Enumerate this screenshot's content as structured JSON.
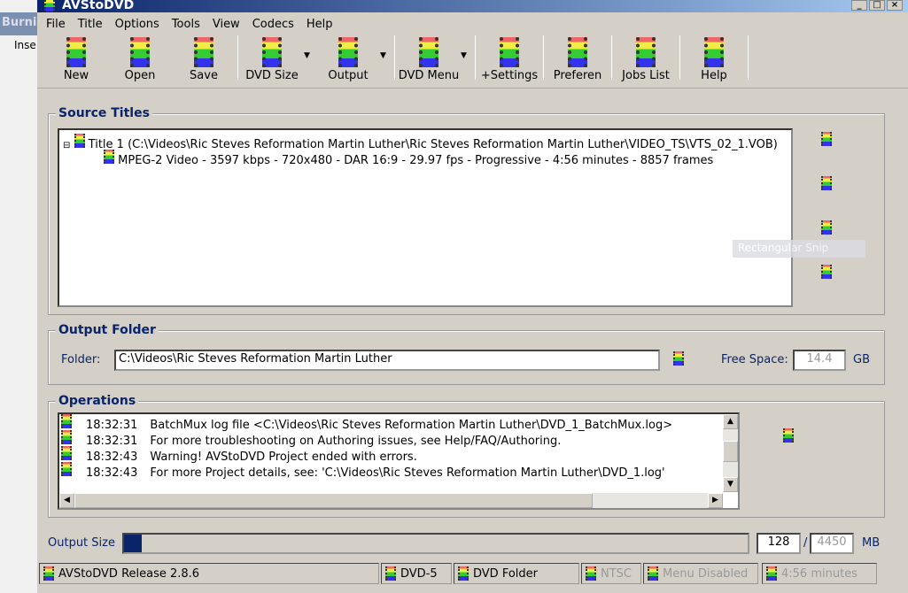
{
  "app": {
    "title": "AVStoDVD"
  },
  "background": {
    "burn_label": "Burnin",
    "insert_label": "Inse"
  },
  "menu": [
    "File",
    "Title",
    "Options",
    "Tools",
    "View",
    "Codecs",
    "Help"
  ],
  "toolbar": [
    {
      "label": "New",
      "dropdown": false,
      "sep_after": false
    },
    {
      "label": "Open",
      "dropdown": false,
      "sep_after": false
    },
    {
      "label": "Save",
      "dropdown": false,
      "sep_after": true
    },
    {
      "label": "DVD Size",
      "dropdown": true,
      "sep_after": false
    },
    {
      "label": "Output",
      "dropdown": true,
      "sep_after": true
    },
    {
      "label": "DVD Menu",
      "dropdown": true,
      "sep_after": true
    },
    {
      "label": "+Settings",
      "dropdown": false,
      "sep_after": true
    },
    {
      "label": "Preferen",
      "dropdown": false,
      "sep_after": true
    },
    {
      "label": "Jobs List",
      "dropdown": false,
      "sep_after": true
    },
    {
      "label": "Help",
      "dropdown": false,
      "sep_after": true
    }
  ],
  "source": {
    "title": "Source Titles",
    "tree_title": "Title 1 (C:\\Videos\\Ric Steves Reformation Martin Luther\\Ric Steves Reformation Martin Luther\\VIDEO_TS\\VTS_02_1.VOB)",
    "tree_child": "MPEG-2 Video - 3597 kbps - 720x480 - DAR 16:9 - 29.97 fps - Progressive - 4:56 minutes - 8857 frames",
    "overlay": "Rectangular Snip"
  },
  "output": {
    "title": "Output Folder",
    "folder_label": "Folder:",
    "folder": "C:\\Videos\\Ric Steves Reformation Martin Luther",
    "free_label": "Free Space:",
    "free": "14.4",
    "unit": "GB"
  },
  "operations": {
    "title": "Operations",
    "log": [
      {
        "time": "18:32:31",
        "text": "BatchMux log file <C:\\Videos\\Ric Steves Reformation Martin Luther\\DVD_1_BatchMux.log>"
      },
      {
        "time": "18:32:31",
        "text": "For more troubleshooting on Authoring issues, see Help/FAQ/Authoring."
      },
      {
        "time": "18:32:43",
        "text": "Warning! AVStoDVD Project ended with errors."
      },
      {
        "time": "18:32:43",
        "text": "For more Project details, see: 'C:\\Videos\\Ric Steves Reformation Martin Luther\\DVD_1.log'"
      }
    ]
  },
  "size": {
    "label": "Output Size",
    "current": "128",
    "max": "4450",
    "unit": "MB",
    "progress_percent": 2.9,
    "bar_color": "#0a246a"
  },
  "statusbar": [
    "AVStoDVD Release 2.8.6",
    "DVD-5",
    "DVD Folder",
    "NTSC",
    "Menu Disabled",
    "4:56 minutes"
  ]
}
